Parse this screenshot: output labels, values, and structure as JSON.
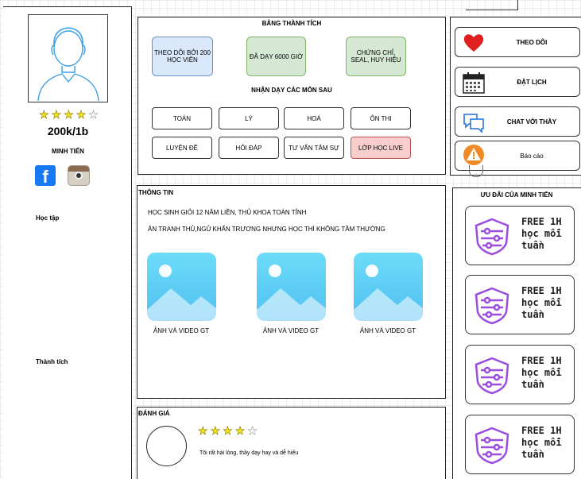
{
  "profile": {
    "rating_filled": 4,
    "rating_total": 5,
    "price": "200k/1b",
    "name": "MINH TIẾN",
    "label_study": "Học tập",
    "label_achievements": "Thành tích"
  },
  "achievements": {
    "title": "BẢNG THÀNH TÍCH",
    "items": [
      {
        "text": "THEO DÕI BỞI 200 HỌC VIÊN",
        "color": "#dae8fc",
        "border": "#6c8ebf"
      },
      {
        "text": "ĐÃ DẠY 6000 GIỜ",
        "color": "#d5e8d4",
        "border": "#82b366"
      },
      {
        "text": "CHỨNG CHỈ, SEAL, HUY HIỆU",
        "color": "#d5e8d4",
        "border": "#82b366"
      }
    ],
    "subjects_title": "NHẬN DẠY CÁC MÔN SAU",
    "subjects": [
      "TOÁN",
      "LÝ",
      "HOÁ",
      "ÔN THI",
      "LUYỆN ĐỀ",
      "HỎI ĐÁP",
      "TƯ VẤN TÂM SỰ",
      "LỚP HỌC LIVE"
    ],
    "highlight_subject_color": "#f8cecc"
  },
  "actions": [
    {
      "label": "THEO DÕI",
      "icon": "heart-icon"
    },
    {
      "label": "ĐẶT LỊCH",
      "icon": "calendar-icon"
    },
    {
      "label": "CHAT VỚI THẦY",
      "icon": "chat-icon"
    },
    {
      "label": "Báo cáo",
      "icon": "warning-icon"
    }
  ],
  "info": {
    "title": "THÔNG TIN",
    "line1": "HỌC SINH GIỎI 12 NĂM LIỀN, THỦ KHOA TOÀN TỈNH",
    "line2": "ĂN TRANH THỦ,NGỦ KHẨN TRƯƠNG NHƯNG HỌC THÌ KHÔNG TẦM THƯỜNG",
    "media_caption": "ẢNH VÀ VIDEO GT"
  },
  "promos": {
    "title": "ƯU ĐÃI CỦA MINH TIẾN",
    "items": [
      {
        "line1": "FREE 1H",
        "line2": "học mỗi",
        "line3": "tuần"
      },
      {
        "line1": "FREE 1H",
        "line2": "học mỗi",
        "line3": "tuần"
      },
      {
        "line1": "FREE 1H",
        "line2": "học mỗi",
        "line3": "tuần"
      },
      {
        "line1": "FREE 1H",
        "line2": "học mỗi",
        "line3": "tuần"
      }
    ],
    "icon": "badge-icon",
    "icon_color": "#9b4de0"
  },
  "review": {
    "title": "ĐÁNH GIÁ",
    "rating_filled": 4,
    "rating_total": 5,
    "text": "Tôi rất hài lòng, thầy dạy hay và dễ hiểu"
  },
  "colors": {
    "heart": "#e02020",
    "chat": "#1e6fd9",
    "warning": "#f08a24",
    "audio": "#f08a24",
    "facebook": "#1877f2"
  }
}
